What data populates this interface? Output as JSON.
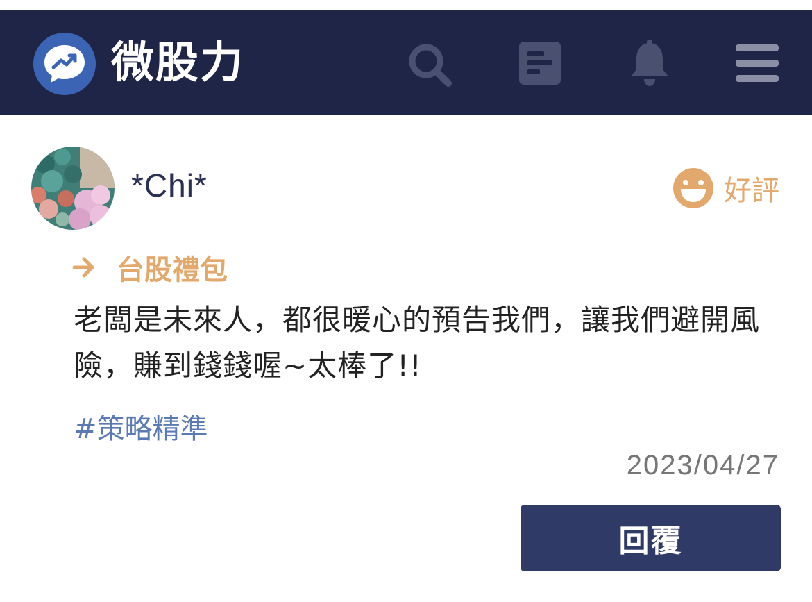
{
  "header": {
    "brand": "微股力",
    "icons": [
      "logo-chat-trend-icon",
      "search-icon",
      "article-icon",
      "bell-icon",
      "menu-icon"
    ]
  },
  "review": {
    "username": "*Chi*",
    "rating_label": "好評",
    "rating_icon": "smile-face-icon",
    "category": "台股禮包",
    "content": "老闆是未來人，都很暖心的預告我們，讓我們避開風險，賺到錢錢喔~太棒了!!",
    "hashtag": "#策略精準",
    "date": "2023/04/27",
    "reply_label": "回覆"
  },
  "colors": {
    "navbar": "#1e2547",
    "logo_blue": "#3c64b4",
    "accent_orange": "#e3a96c",
    "hashtag_blue": "#5b7ab4",
    "button": "#2f3a66",
    "icon_gray": "#4a5070"
  }
}
